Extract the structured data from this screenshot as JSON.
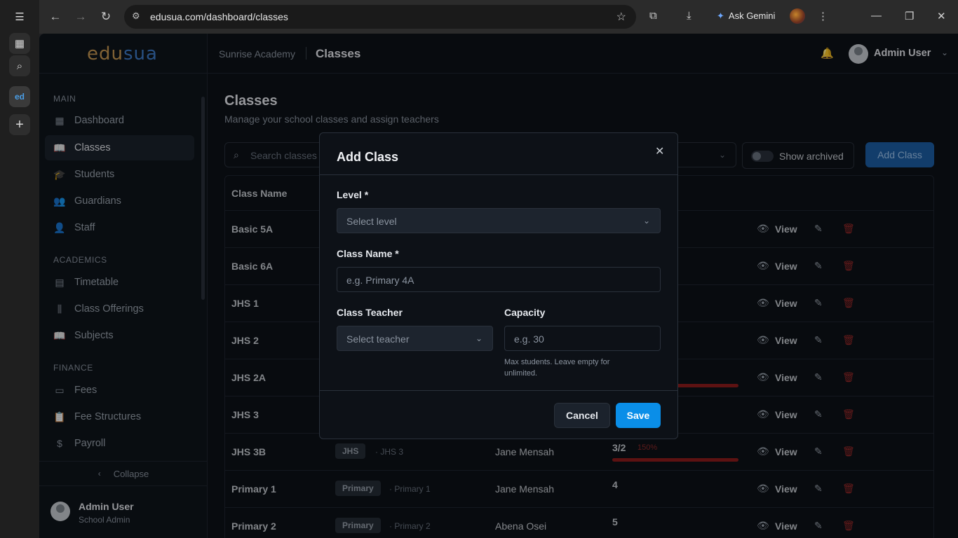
{
  "browser": {
    "url": "edusua.com/dashboard/classes",
    "gemini_label": "Ask Gemini"
  },
  "logo": {
    "part1": "edu",
    "part2": "sua"
  },
  "sidebar": {
    "sections": [
      {
        "title": "MAIN",
        "items": [
          {
            "label": "Dashboard",
            "icon": "grid-icon"
          },
          {
            "label": "Classes",
            "icon": "book-icon",
            "active": true
          },
          {
            "label": "Students",
            "icon": "cap-icon"
          },
          {
            "label": "Guardians",
            "icon": "users-icon"
          },
          {
            "label": "Staff",
            "icon": "user-icon"
          }
        ]
      },
      {
        "title": "ACADEMICS",
        "items": [
          {
            "label": "Timetable",
            "icon": "calendar-icon"
          },
          {
            "label": "Class Offerings",
            "icon": "library-icon"
          },
          {
            "label": "Subjects",
            "icon": "book-icon"
          }
        ]
      },
      {
        "title": "FINANCE",
        "items": [
          {
            "label": "Fees",
            "icon": "wallet-icon"
          },
          {
            "label": "Fee Structures",
            "icon": "clipboard-icon"
          },
          {
            "label": "Payroll",
            "icon": "dollar-icon"
          }
        ]
      }
    ],
    "collapse_label": "Collapse",
    "user": {
      "name": "Admin User",
      "role": "School Admin"
    }
  },
  "header": {
    "school": "Sunrise Academy",
    "page": "Classes",
    "user_name": "Admin User"
  },
  "main": {
    "title": "Classes",
    "subtitle": "Manage your school classes and assign teachers",
    "search_placeholder": "Search classes",
    "show_archived": "Show archived",
    "add_button": "Add Class",
    "col_class_name": "Class Name",
    "view_label": "View",
    "rows": [
      {
        "name": "Basic 5A",
        "level": "",
        "level_sub": "",
        "teacher": "",
        "capacity": "",
        "pct": "",
        "bar": false
      },
      {
        "name": "Basic 6A",
        "level": "",
        "level_sub": "",
        "teacher": "",
        "capacity": "",
        "pct": "",
        "bar": false
      },
      {
        "name": "JHS 1",
        "level": "",
        "level_sub": "",
        "teacher": "",
        "capacity": "",
        "pct": "",
        "bar": false
      },
      {
        "name": "JHS 2",
        "level": "",
        "level_sub": "",
        "teacher": "",
        "capacity": "",
        "pct": "",
        "bar": false
      },
      {
        "name": "JHS 2A",
        "level": "",
        "level_sub": "",
        "teacher": "",
        "capacity": "",
        "pct": "",
        "bar": true
      },
      {
        "name": "JHS 3",
        "level": "",
        "level_sub": "",
        "teacher": "",
        "capacity": "",
        "pct": "",
        "bar": false
      },
      {
        "name": "JHS 3B",
        "level": "JHS",
        "level_sub": "· JHS 3",
        "teacher": "Jane Mensah",
        "capacity": "3/2",
        "pct": "150%",
        "bar": true
      },
      {
        "name": "Primary 1",
        "level": "Primary",
        "level_sub": "· Primary 1",
        "teacher": "Jane Mensah",
        "capacity": "4",
        "pct": "",
        "bar": false
      },
      {
        "name": "Primary 2",
        "level": "Primary",
        "level_sub": "· Primary 2",
        "teacher": "Abena Osei",
        "capacity": "5",
        "pct": "",
        "bar": false
      }
    ]
  },
  "modal": {
    "title": "Add Class",
    "level_label": "Level *",
    "level_placeholder": "Select level",
    "class_name_label": "Class Name *",
    "class_name_placeholder": "e.g. Primary 4A",
    "teacher_label": "Class Teacher",
    "teacher_placeholder": "Select teacher",
    "capacity_label": "Capacity",
    "capacity_placeholder": "e.g. 30",
    "capacity_help": "Max students. Leave empty for unlimited.",
    "cancel": "Cancel",
    "save": "Save"
  }
}
